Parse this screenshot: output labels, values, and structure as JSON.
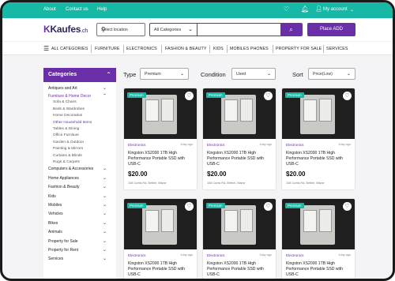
{
  "topbar": {
    "links": [
      "About",
      "Contact us",
      "Help"
    ],
    "account_label": "My account",
    "icons": [
      "heart-icon",
      "bell-icon",
      "user-icon",
      "chevron-down-icon"
    ]
  },
  "header": {
    "logo_text": "Kaufes",
    "logo_suffix": ".ch",
    "location_placeholder": "Select location",
    "category_select": "All Categories",
    "search_value": "",
    "place_ad": "Place ADD"
  },
  "nav": {
    "all_categories": "ALL CATEGORIES",
    "items": [
      "FURNITURE",
      "ELECTRONICS",
      "FASHION & BEAUTY",
      "KIDS",
      "MOBILES PHONES",
      "PROPERTY FOR SALE",
      "SERVICES"
    ]
  },
  "sidebar": {
    "title": "Categories",
    "items": [
      {
        "label": "Antiques and Art",
        "sub": false,
        "active": false,
        "chevron": true
      },
      {
        "label": "Furniture & Home Decor",
        "sub": false,
        "active": true,
        "chevron": true
      },
      {
        "label": "Sofa & Chairs",
        "sub": true,
        "active": false,
        "chevron": false
      },
      {
        "label": "Beds & Wardrobes",
        "sub": true,
        "active": false,
        "chevron": false
      },
      {
        "label": "Home Decoration",
        "sub": true,
        "active": false,
        "chevron": false
      },
      {
        "label": "Other Household Items",
        "sub": true,
        "active": true,
        "chevron": false
      },
      {
        "label": "Tables & Dining",
        "sub": true,
        "active": false,
        "chevron": false
      },
      {
        "label": "Office Furniture",
        "sub": true,
        "active": false,
        "chevron": false
      },
      {
        "label": "Garden & Outdoor",
        "sub": true,
        "active": false,
        "chevron": false
      },
      {
        "label": "Painting & Mirrors",
        "sub": true,
        "active": false,
        "chevron": false
      },
      {
        "label": "Curtains & Blinds",
        "sub": true,
        "active": false,
        "chevron": false
      },
      {
        "label": "Rugs & Carpets",
        "sub": true,
        "active": false,
        "chevron": false
      },
      {
        "label": "Computers & Accessories",
        "sub": false,
        "active": false,
        "chevron": true
      },
      {
        "label": "Home Appliances",
        "sub": false,
        "active": false,
        "chevron": true
      },
      {
        "label": "Fashion & Beauty",
        "sub": false,
        "active": false,
        "chevron": true
      },
      {
        "label": "Kids",
        "sub": false,
        "active": false,
        "chevron": true
      },
      {
        "label": "Mobiles",
        "sub": false,
        "active": false,
        "chevron": true
      },
      {
        "label": "Vehicles",
        "sub": false,
        "active": false,
        "chevron": true
      },
      {
        "label": "Bikes",
        "sub": false,
        "active": false,
        "chevron": true
      },
      {
        "label": "Animals",
        "sub": false,
        "active": false,
        "chevron": true
      },
      {
        "label": "Property for Sale",
        "sub": false,
        "active": false,
        "chevron": true
      },
      {
        "label": "Property for Rent",
        "sub": false,
        "active": false,
        "chevron": true
      },
      {
        "label": "Services",
        "sub": false,
        "active": false,
        "chevron": true
      }
    ]
  },
  "filters": {
    "type": {
      "label": "Type",
      "value": "Premium"
    },
    "condition": {
      "label": "Condition",
      "value": "Used"
    },
    "sort": {
      "label": "Sort",
      "value": "Price(Low)"
    }
  },
  "listings": [
    {
      "badge": "Premium",
      "category": "Electronics",
      "time": "1day ago",
      "title": "Kingston XS2000 1TB High Performance Portable SSD with USB-C",
      "price": "$20.00",
      "address": "108 Curtis Rd, Bethel, Maine"
    },
    {
      "badge": "Premium",
      "category": "Electronics",
      "time": "1day ago",
      "title": "Kingston XS2000 1TB High Performance Portable SSD with USB-C",
      "price": "$20.00",
      "address": "108 Curtis Rd, Bethel, Maine"
    },
    {
      "badge": "Premium",
      "category": "Electronics",
      "time": "1day ago",
      "title": "Kingston XS2000 1TB High Performance Portable SSD with USB-C",
      "price": "$20.00",
      "address": "108 Curtis Rd, Bethel, Maine"
    },
    {
      "badge": "Premium",
      "category": "Electronics",
      "time": "1day ago",
      "title": "Kingston XS2000 1TB High Performance Portable SSD with USB-C",
      "price": "",
      "address": ""
    },
    {
      "badge": "Premium",
      "category": "Electronics",
      "time": "1day ago",
      "title": "Kingston XS2000 1TB High Performance Portable SSD with USB-C",
      "price": "",
      "address": ""
    },
    {
      "badge": "Premium",
      "category": "Electronics",
      "time": "1day ago",
      "title": "Kingston XS2000 1TB High Performance Portable SSD with USB-C",
      "price": "",
      "address": ""
    }
  ],
  "colors": {
    "teal": "#18b8a6",
    "purple": "#6a2fa8",
    "navy": "#2c2560"
  }
}
